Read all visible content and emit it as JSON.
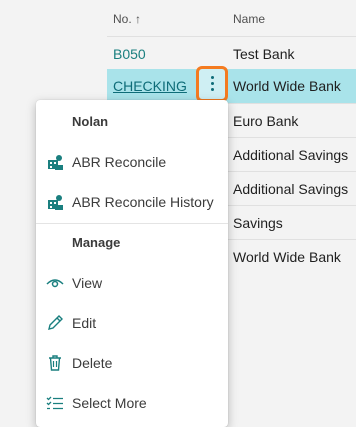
{
  "table": {
    "columns": {
      "no": "No. ↑",
      "name": "Name"
    },
    "rows": [
      {
        "no": "B050",
        "name": "Test Bank"
      },
      {
        "no": "CHECKING",
        "name": "World Wide Bank"
      },
      {
        "no": "",
        "name": "Euro Bank"
      },
      {
        "no": "",
        "name": "Additional Savings"
      },
      {
        "no": "",
        "name": "Additional Savings"
      },
      {
        "no": "",
        "name": "Savings"
      },
      {
        "no": "",
        "name": "World Wide Bank"
      }
    ]
  },
  "menu": {
    "group1": "Nolan",
    "group2": "Manage",
    "items": [
      {
        "label": "ABR Reconcile",
        "icon": "abr-reconcile-icon"
      },
      {
        "label": "ABR Reconcile History",
        "icon": "abr-reconcile-history-icon"
      },
      {
        "label": "View",
        "icon": "eye-icon"
      },
      {
        "label": "Edit",
        "icon": "pencil-icon"
      },
      {
        "label": "Delete",
        "icon": "trash-icon"
      },
      {
        "label": "Select More",
        "icon": "checklist-icon"
      }
    ]
  },
  "colors": {
    "accent": "#1a7f7f",
    "selected_row": "#a9e3ea",
    "highlight": "#f47b20"
  }
}
